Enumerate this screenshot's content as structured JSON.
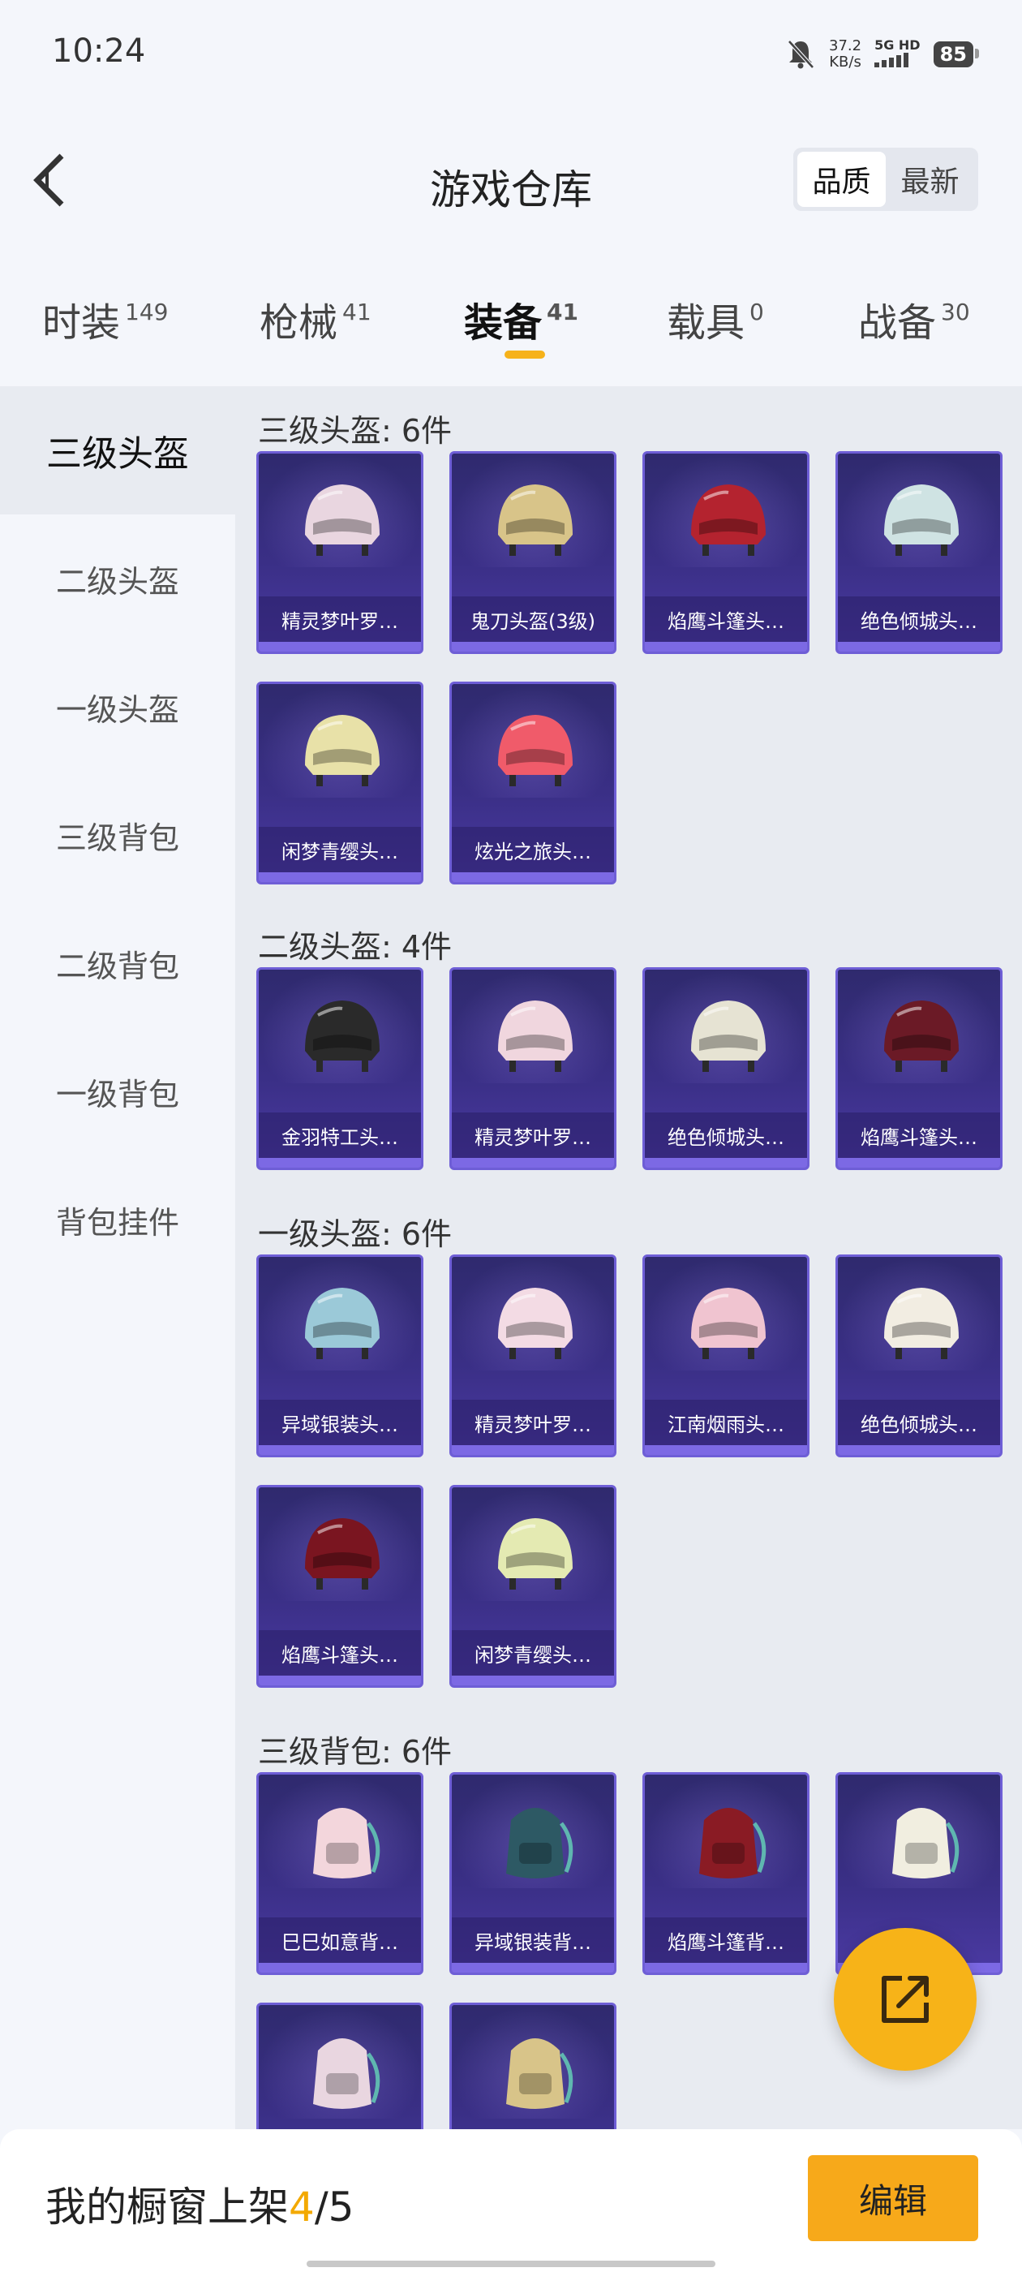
{
  "status": {
    "time": "10:24",
    "speed": "37.2",
    "speed_unit": "KB/s",
    "network": "5G HD",
    "battery": "85"
  },
  "header": {
    "title": "游戏仓库",
    "sort_quality": "品质",
    "sort_latest": "最新"
  },
  "tabs": [
    {
      "label": "时装",
      "count": "149"
    },
    {
      "label": "枪械",
      "count": "41"
    },
    {
      "label": "装备",
      "count": "41"
    },
    {
      "label": "载具",
      "count": "0"
    },
    {
      "label": "战备",
      "count": "30"
    }
  ],
  "sidebar": [
    "三级头盔",
    "二级头盔",
    "一级头盔",
    "三级背包",
    "二级背包",
    "一级背包",
    "背包挂件"
  ],
  "sections": [
    {
      "title": "三级头盔: 6件",
      "items": [
        "精灵梦叶罗…",
        "鬼刀头盔(3级)",
        "焰鹰斗篷头…",
        "绝色倾城头…",
        "闲梦青缨头…",
        "炫光之旅头…"
      ]
    },
    {
      "title": "二级头盔: 4件",
      "items": [
        "金羽特工头…",
        "精灵梦叶罗…",
        "绝色倾城头…",
        "焰鹰斗篷头…"
      ]
    },
    {
      "title": "一级头盔: 6件",
      "items": [
        "异域银装头…",
        "精灵梦叶罗…",
        "江南烟雨头…",
        "绝色倾城头…",
        "焰鹰斗篷头…",
        "闲梦青缨头…"
      ]
    },
    {
      "title": "三级背包: 6件",
      "items": [
        "巳巳如意背…",
        "异域银装背…",
        "焰鹰斗篷背…",
        "",
        "",
        ""
      ]
    }
  ],
  "bottom": {
    "showcase_label": "我的橱窗上架",
    "showcase_count": "4",
    "showcase_total": "/5",
    "edit_label": "编辑"
  },
  "colors": {
    "accent": "#f7a91a",
    "card_bg": "#3a2f86",
    "card_border": "#6e5ed6"
  }
}
